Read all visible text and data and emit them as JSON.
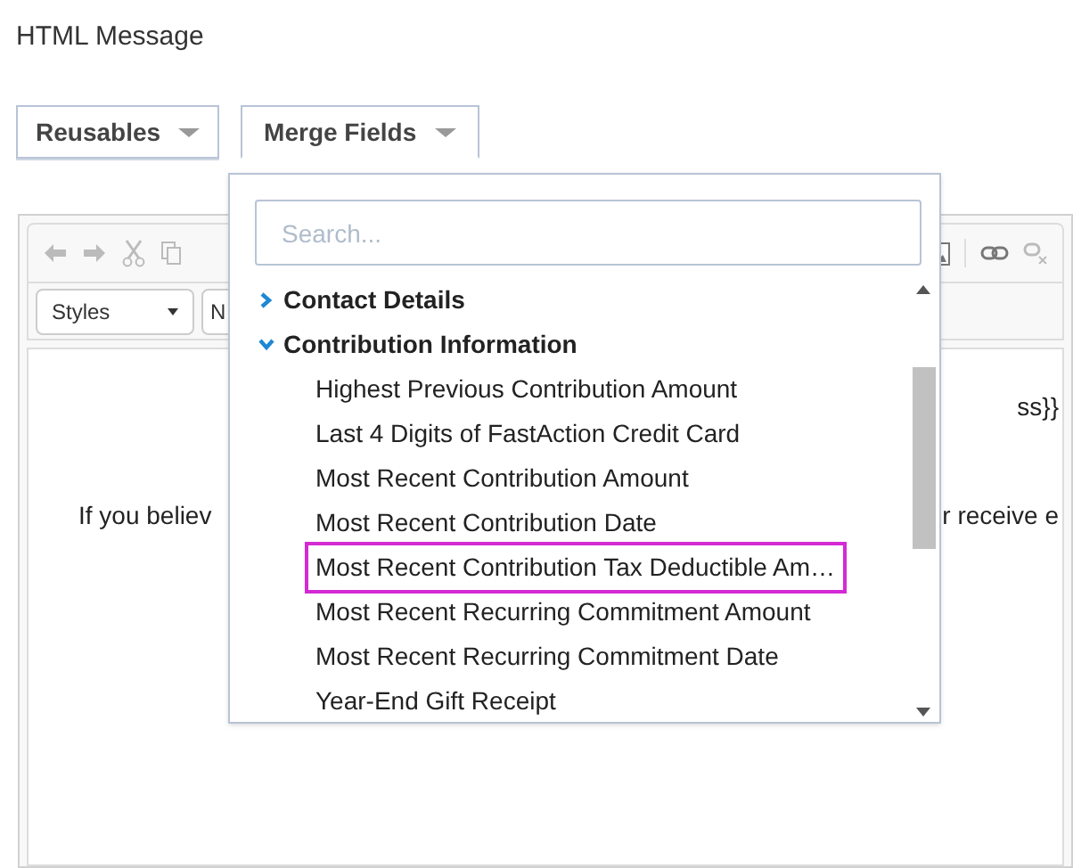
{
  "heading": "HTML Message",
  "buttons": [
    {
      "label": "Reusables",
      "selected": false
    },
    {
      "label": "Merge Fields",
      "selected": true
    }
  ],
  "editor": {
    "style_combo": "Styles",
    "format_combo": "N",
    "lines": [
      {
        "right": "ss}}"
      },
      {
        "left": "If you believ",
        "right": "r receive e"
      }
    ]
  },
  "merge_menu": {
    "search": {
      "placeholder": "Search..."
    },
    "tree": [
      {
        "label": "Contact Details",
        "expanded": false
      },
      {
        "label": "Contribution Information",
        "expanded": true,
        "children": [
          {
            "label": "Highest Previous Contribution Amount",
            "selected": false
          },
          {
            "label": "Last 4 Digits of FastAction Credit Card",
            "selected": false
          },
          {
            "label": "Most Recent Contribution Amount",
            "selected": false
          },
          {
            "label": "Most Recent Contribution Date",
            "selected": false
          },
          {
            "label": "Most Recent Contribution Tax Deductible Am…",
            "selected": true
          },
          {
            "label": "Most Recent Recurring Commitment Amount",
            "selected": false
          },
          {
            "label": "Most Recent Recurring Commitment Date",
            "selected": false
          },
          {
            "label": "Year-End Gift Receipt",
            "selected": false
          }
        ]
      }
    ]
  }
}
